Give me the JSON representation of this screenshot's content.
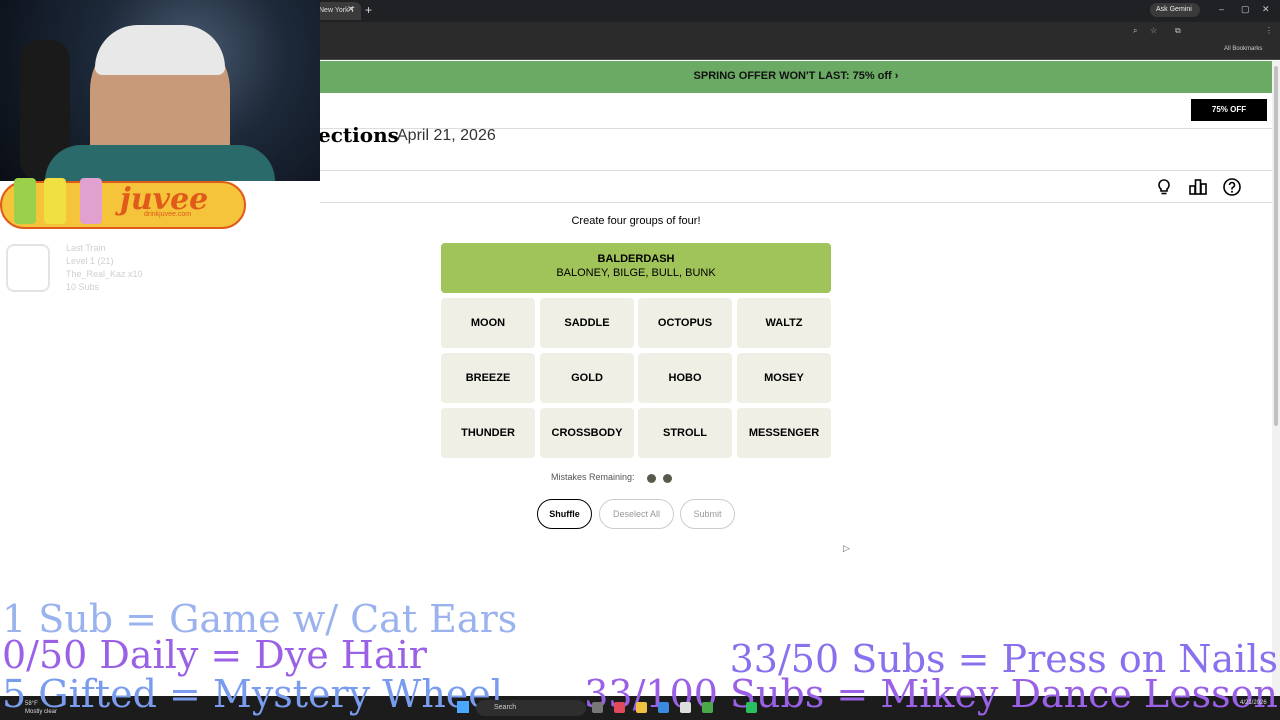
{
  "browser": {
    "tab_title": "New York T",
    "tab_close": "✕",
    "new_tab": "+",
    "ask_gemini": "Ask Gemini",
    "all_bookmarks": "All Bookmarks",
    "window_controls": [
      "–",
      "▢",
      "✕"
    ]
  },
  "promo": {
    "text": "SPRING OFFER WON'T LAST:  75% off ›",
    "offer_button": "75% OFF"
  },
  "header": {
    "title": "ections",
    "date": "April 21, 2026",
    "icons": [
      "lightbulb-icon",
      "stats-icon",
      "help-icon"
    ]
  },
  "game": {
    "instructions": "Create four groups of four!",
    "solved": {
      "name": "BALDERDASH",
      "words": "BALONEY, BILGE, BULL, BUNK",
      "color": "#a0c35a"
    },
    "tiles": [
      [
        "MOON",
        "SADDLE",
        "OCTOPUS",
        "WALTZ"
      ],
      [
        "BREEZE",
        "GOLD",
        "HOBO",
        "MOSEY"
      ],
      [
        "THUNDER",
        "CROSSBODY",
        "STROLL",
        "MESSENGER"
      ]
    ],
    "mistakes_label": "Mistakes Remaining:",
    "mistakes_remaining": 2,
    "buttons": {
      "shuffle": "Shuffle",
      "deselect": "Deselect All",
      "submit": "Submit"
    }
  },
  "overlay": {
    "sponsor_logo": "juvee",
    "sponsor_url": "drinkjuvee.com",
    "alert_lines": [
      "Last Train",
      "Level 1  (21)",
      "The_Real_Kaz x10",
      "10 Subs"
    ],
    "goals_left": [
      "1 Sub = Game w/ Cat Ears",
      "0/50 Daily = Dye Hair",
      "5 Gifted = Mystery Wheel"
    ],
    "goals_right": [
      "33/50 Subs = Press on Nails",
      "33/100 Subs = Mikey Dance Lesson"
    ]
  },
  "taskbar": {
    "weather_temp": "58°F",
    "weather_desc": "Mostly clear",
    "search_placeholder": "Search",
    "time": "",
    "date": "4/21/2026"
  }
}
